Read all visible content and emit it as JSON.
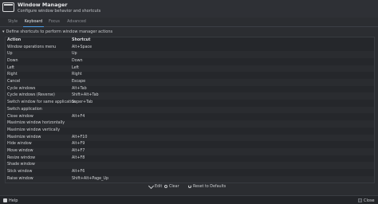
{
  "header": {
    "title": "Window Manager",
    "subtitle": "Configure window behavior and shortcuts"
  },
  "tabs": [
    {
      "label": "Style"
    },
    {
      "label": "Keyboard"
    },
    {
      "label": "Focus"
    },
    {
      "label": "Advanced"
    }
  ],
  "section": {
    "label": "Define shortcuts to perform window manager actions"
  },
  "table": {
    "headers": {
      "action": "Action",
      "shortcut": "Shortcut"
    },
    "rows": [
      {
        "action": "Window operations menu",
        "shortcut": "Alt+Space"
      },
      {
        "action": "Up",
        "shortcut": "Up"
      },
      {
        "action": "Down",
        "shortcut": "Down"
      },
      {
        "action": "Left",
        "shortcut": "Left"
      },
      {
        "action": "Right",
        "shortcut": "Right"
      },
      {
        "action": "Cancel",
        "shortcut": "Escape"
      },
      {
        "action": "Cycle windows",
        "shortcut": "Alt+Tab"
      },
      {
        "action": "Cycle windows (Reverse)",
        "shortcut": "Shift+Alt+Tab"
      },
      {
        "action": "Switch window for same application",
        "shortcut": "Super+Tab"
      },
      {
        "action": "Switch application",
        "shortcut": ""
      },
      {
        "action": "Close window",
        "shortcut": "Alt+F4"
      },
      {
        "action": "Maximize window horizontally",
        "shortcut": ""
      },
      {
        "action": "Maximize window vertically",
        "shortcut": ""
      },
      {
        "action": "Maximize window",
        "shortcut": "Alt+F10"
      },
      {
        "action": "Hide window",
        "shortcut": "Alt+F9"
      },
      {
        "action": "Move window",
        "shortcut": "Alt+F7"
      },
      {
        "action": "Resize window",
        "shortcut": "Alt+F8"
      },
      {
        "action": "Shade window",
        "shortcut": ""
      },
      {
        "action": "Stick window",
        "shortcut": "Alt+F6"
      },
      {
        "action": "Raise window",
        "shortcut": "Shift+Alt+Page_Up"
      }
    ]
  },
  "buttons": {
    "edit": "Edit",
    "clear": "Clear",
    "reset": "Reset to Defaults"
  },
  "footer": {
    "help": "Help",
    "close": "Close"
  },
  "colors": {
    "accent": "#4a9de8",
    "background": "#2b2d31"
  }
}
